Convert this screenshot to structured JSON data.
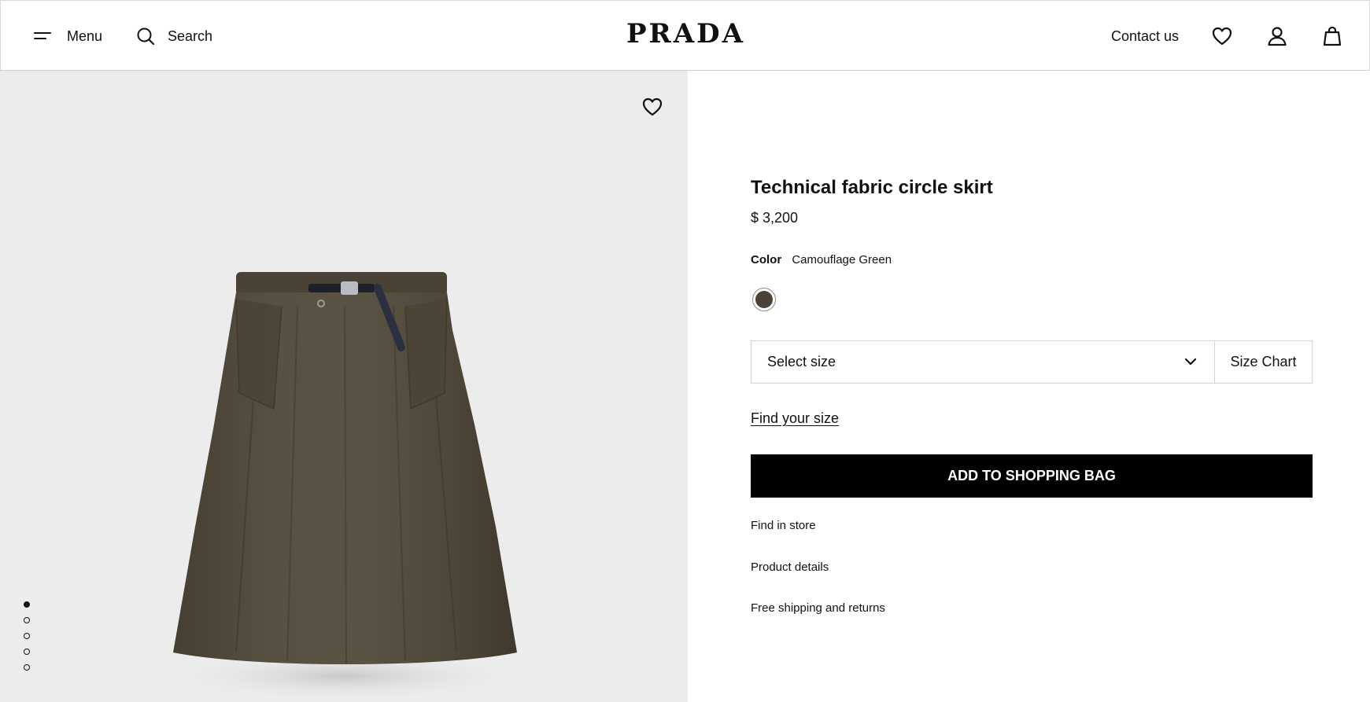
{
  "header": {
    "menu_label": "Menu",
    "search_label": "Search",
    "logo": "PRADA",
    "contact_label": "Contact us"
  },
  "product": {
    "title": "Technical fabric circle skirt",
    "price": "$ 3,200",
    "color_key": "Color",
    "color_value": "Camouflage Green",
    "swatch_color": "#4a4235",
    "size_placeholder": "Select size",
    "size_chart_label": "Size Chart",
    "find_size_label": "Find your size",
    "add_to_bag_label": "ADD TO SHOPPING BAG",
    "links": [
      "Find in store",
      "Product details",
      "Free shipping and returns"
    ]
  },
  "gallery": {
    "image_count": 5,
    "active_index": 0,
    "skirt_color": "#524a3b"
  }
}
